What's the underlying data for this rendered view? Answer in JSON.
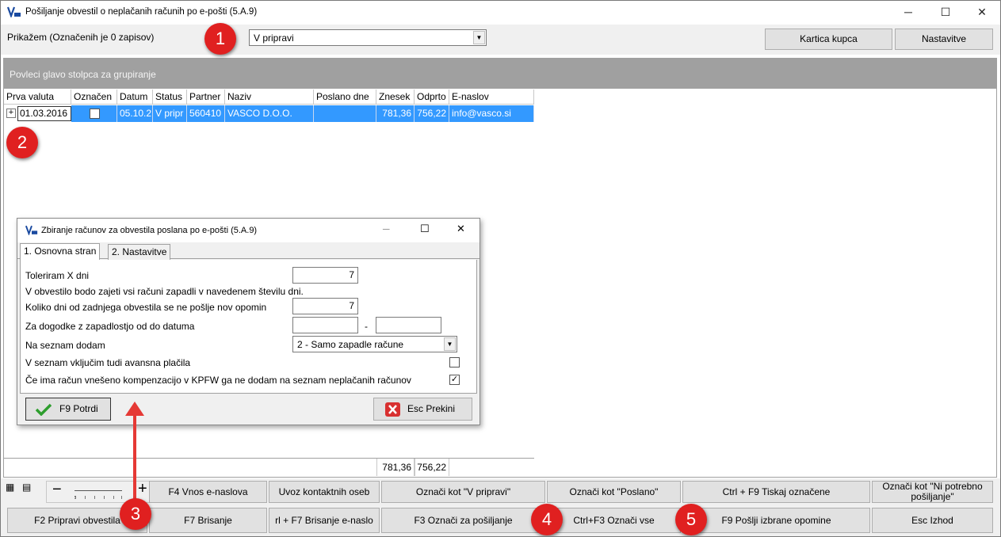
{
  "window": {
    "title": "Pošiljanje obvestil o neplačanih računih po e-pošti  (5.A.9)",
    "minimize": "─",
    "maximize": "☐",
    "close": "✕"
  },
  "toolbar": {
    "show_label": "Prikažem (Označenih je 0 zapisov)",
    "filter_value": "V pripravi",
    "customer_card_button": "Kartica kupca",
    "settings_button": "Nastavitve"
  },
  "grid": {
    "group_hint": "Povleci glavo stolpca za grupiranje",
    "columns": [
      "Prva valuta",
      "Označen",
      "Datum",
      "Status",
      "Partner",
      "Naziv",
      "Poslano dne",
      "Znesek",
      "Odprto",
      "E-naslov"
    ],
    "rows": [
      {
        "expand": "+",
        "prva_valuta": "01.03.2016",
        "oznacen": false,
        "datum": "05.10.2",
        "status": "V pripr",
        "partner": "560410",
        "naziv": "VASCO D.O.O.",
        "poslano_dne": "",
        "znesek": "781,36",
        "odprto": "756,22",
        "e_naslov": "info@vasco.si"
      }
    ],
    "totals": {
      "znesek": "781,36",
      "odprto": "756,22"
    }
  },
  "dialog": {
    "title": "Zbiranje računov za obvestila poslana po e-pošti  (5.A.9)",
    "tabs": [
      "1. Osnovna stran",
      "2. Nastavitve"
    ],
    "tolerance_label": "Toleriram X dni",
    "tolerance_value": "7",
    "tolerance_note": "V obvestilo bodo zajeti vsi računi zapadli v navedenem številu dni.",
    "days_label": "Koliko dni od zadnjega obvestila se ne pošlje nov opomin",
    "days_value": "7",
    "date_range_label": "Za dogodke z zapadlostjo od do datuma",
    "date_from": "",
    "date_to": "",
    "date_sep": "-",
    "list_label": "Na seznam dodam",
    "list_value": "2 - Samo zapadle račune",
    "advance_label": "V seznam vključim tudi avansna plačila",
    "advance_checked": false,
    "compensation_label": "Če ima račun vnešeno kompenzacijo v KPFW ga ne dodam na seznam neplačanih računov",
    "compensation_checked": true,
    "confirm_button": "F9 Potrdi",
    "cancel_button": "Esc Prekini"
  },
  "buttons": {
    "row1": [
      "F4 Vnos e-naslova",
      "Uvoz kontaktnih oseb",
      "Označi kot \"V pripravi\"",
      "Označi kot \"Poslano\"",
      "Ctrl + F9 Tiskaj označene",
      "Označi kot \"Ni potrebno pošiljanje\""
    ],
    "row2": [
      "F2 Pripravi obvestila",
      "F7 Brisanje",
      "rl + F7 Brisanje e-naslo",
      "F3 Označi za pošiljanje",
      "Ctrl+F3 Označi vse",
      "F9 Pošlji izbrane opomine",
      "Esc Izhod"
    ],
    "zoom_minus": "−",
    "zoom_plus": "+"
  },
  "annotations": [
    "1",
    "2",
    "3",
    "4",
    "5"
  ],
  "colors": {
    "selection": "#3399ff",
    "badge": "#e02020",
    "group_bar": "#a0a0a0",
    "arrow": "#e53935"
  }
}
